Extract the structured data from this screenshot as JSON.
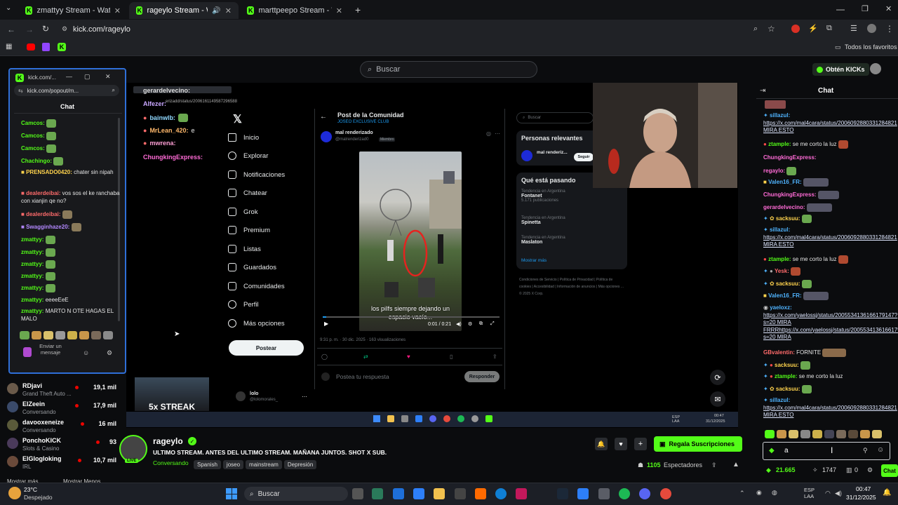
{
  "browser": {
    "tabs": [
      {
        "title": "zmattyy Stream - Watch Live o",
        "active": false
      },
      {
        "title": "rageylo Stream - Watch Liv",
        "active": true
      },
      {
        "title": "marttpeepo Stream - Watch Li",
        "active": false
      }
    ],
    "url": "kick.com/rageylo",
    "bookmarks_all": "Todos los favoritos"
  },
  "kick_header": {
    "search_placeholder": "Buscar",
    "get_kicks": "Obtén KICKs"
  },
  "popup": {
    "title": "kick.com/...",
    "url": "kick.com/popout/m...",
    "chat_title": "Chat",
    "messages": [
      {
        "user": "Camcos:",
        "text": "",
        "color": "#53fc18"
      },
      {
        "user": "Camcos:",
        "text": "",
        "color": "#53fc18"
      },
      {
        "user": "Camcos:",
        "text": "",
        "color": "#53fc18"
      },
      {
        "user": "Chachingo:",
        "text": "",
        "color": "#53fc18"
      },
      {
        "user": "PRENSADO0420:",
        "text": "chater sin nipah",
        "color": "#ffd34d"
      },
      {
        "user": "dealerdeibai:",
        "text": "vos sos el ke ranchaba con xianjin qe no?",
        "color": "#ff6b6b"
      },
      {
        "user": "dealerdeibai:",
        "text": "",
        "color": "#ff6b6b"
      },
      {
        "user": "Swagginhaze20:",
        "text": "",
        "color": "#b388ff"
      },
      {
        "user": "zmattyy:",
        "text": "",
        "color": "#53fc18"
      },
      {
        "user": "zmattyy:",
        "text": "",
        "color": "#53fc18"
      },
      {
        "user": "zmattyy:",
        "text": "",
        "color": "#53fc18"
      },
      {
        "user": "zmattyy:",
        "text": "",
        "color": "#53fc18"
      },
      {
        "user": "zmattyy:",
        "text": "",
        "color": "#53fc18"
      },
      {
        "user": "zmattyy:",
        "text": "eeeeEeE",
        "color": "#53fc18"
      },
      {
        "user": "zmattyy:",
        "text": "MARTO N OTE HAGAS EL MALO",
        "color": "#53fc18"
      }
    ],
    "input_placeholder": "Enviar un mensaje"
  },
  "sidebar": {
    "channels": [
      {
        "name": "RDjavi",
        "category": "Grand Theft Auto ...",
        "viewers": "19,1 mil"
      },
      {
        "name": "ElZeein",
        "category": "Conversando",
        "viewers": "17,9 mil"
      },
      {
        "name": "davooxeneize",
        "category": "Conversando",
        "viewers": "16 mil"
      },
      {
        "name": "PonchoKICK",
        "category": "Slots & Casino",
        "viewers": "93"
      },
      {
        "name": "ElGlogloking",
        "category": "IRL",
        "viewers": "10,7 mil"
      }
    ],
    "show_more": "Mostrar más",
    "show_less": "Mostrar Menos"
  },
  "stream_overlay": {
    "chat": [
      {
        "user": "gerardelvecino:",
        "text": ""
      },
      {
        "user": "Alfezer:",
        "text": ""
      },
      {
        "user": "bainwlb:",
        "text": ""
      },
      {
        "user": "MrLean_420:",
        "text": "e"
      },
      {
        "user": "mwrena:",
        "text": ""
      },
      {
        "user": "ChungkingExpress:",
        "text": ""
      }
    ],
    "streak": "5x STREAK",
    "url_strip": "erizadd/status/2006161149587296588"
  },
  "x_page": {
    "nav": [
      "Inicio",
      "Explorar",
      "Notificaciones",
      "Chatear",
      "Grok",
      "Premium",
      "Listas",
      "Guardados",
      "Comunidades",
      "Perfil",
      "Más opciones"
    ],
    "post_button": "Postear",
    "account_name": "lolo",
    "account_handle": "@lolomorales_",
    "post_header": "Post de la Comunidad",
    "community": "JOSEO EXCLUSIVE CLUB",
    "author": "mal renderizado",
    "handle": "@malrenderizad0",
    "member": "Miembro",
    "caption": "los piIfs siempre dejando un espacio vacío...",
    "video_time": "0:01 / 0:21",
    "meta": "9:31 p. m. · 30 dic. 2025 · 163 visualizaciones",
    "reply_placeholder": "Postea tu respuesta",
    "reply_button": "Responder",
    "search": "Buscar",
    "relevant_title": "Personas relevantes",
    "relevant_name": "mal renderiz...",
    "relevant_follow": "Seguir",
    "happening_title": "Qué está pasando",
    "trends": [
      {
        "context": "Tendencia en Argentina",
        "name": "Fontanet",
        "count": "5.171 publicaciones"
      },
      {
        "context": "Tendencia en Argentina",
        "name": "Spinetta",
        "count": ""
      },
      {
        "context": "Tendencia en Argentina",
        "name": "Maslaton",
        "count": ""
      }
    ],
    "show_more": "Mostrar más",
    "footer": "Condiciones de Servicio | Política de Privacidad | Política de cookies | Accesibilidad | Información de anuncios | Más opciones ... © 2025 X Corp."
  },
  "inner_taskbar": {
    "lang": "ESP\nLAA",
    "time": "00:47",
    "date": "31/12/2025"
  },
  "right_chat": {
    "title": "Chat",
    "messages": [
      {
        "user": "sillazul:",
        "text": "https://x.com/mal4cara/status/2006092880331284821 MIRA ESTO",
        "color": "#4fb3ff",
        "link": true
      },
      {
        "user": "ztample:",
        "text": "se me corto la luz",
        "color": "#53fc18"
      },
      {
        "user": "ChungkingExpress:",
        "text": "",
        "color": "#ff6bd6"
      },
      {
        "user": "regaylo:",
        "text": "",
        "color": "#ff6bd6"
      },
      {
        "user": "Valen16_FR:",
        "text": "",
        "color": "#4fb3ff"
      },
      {
        "user": "ChungkingExpress:",
        "text": "",
        "color": "#ff6bd6"
      },
      {
        "user": "gerardelvecino:",
        "text": "",
        "color": "#ff6bd6"
      },
      {
        "user": "sacksuu:",
        "text": "",
        "color": "#ffd34d"
      },
      {
        "user": "sillazul:",
        "text": "https://x.com/mal4cara/status/2006092880331284821 MIRA ESTO",
        "color": "#4fb3ff",
        "link": true
      },
      {
        "user": "ztample:",
        "text": "se me corto la luz",
        "color": "#53fc18"
      },
      {
        "user": "Yesk:",
        "text": "",
        "color": "#ff6b6b"
      },
      {
        "user": "sacksuu:",
        "text": "",
        "color": "#ffd34d"
      },
      {
        "user": "Valen16_FR:",
        "text": "",
        "color": "#4fb3ff"
      },
      {
        "user": "yaeloxz:",
        "text": "https://x.com/yaelossj/status/2005534136166179147?s=20 MIRA FRRRhttps://x.com/yaelossj/status/2005534136166179147?s=20 MIRA",
        "color": "#4fb3ff",
        "link": true
      },
      {
        "user": "GBvalentin:",
        "text": "FORNITE",
        "color": "#ff6b6b"
      },
      {
        "user": "sacksuu:",
        "text": "",
        "color": "#ffd34d"
      },
      {
        "user": "ztample:",
        "text": "se me corto la luz",
        "color": "#53fc18"
      },
      {
        "user": "sacksuu:",
        "text": "",
        "color": "#ffd34d"
      },
      {
        "user": "sillazul:",
        "text": "https://x.com/mal4cara/status/2006092880331284821 MIRA ESTO",
        "color": "#4fb3ff",
        "link": true
      }
    ],
    "input_value": "a",
    "kicks": "21.665",
    "points": "1747",
    "misc": "0",
    "chat_button": "Chat"
  },
  "stream": {
    "streamer": "rageylo",
    "title": "ULTIMO STREAM. ANTES DEL ULTIMO STREAM. MAÑANA JUNTOS. SHOT X SUB.",
    "category": "Conversando",
    "tags": [
      "Spanish",
      "joseo",
      "mainstream",
      "Depresión"
    ],
    "live": "LIVE",
    "gift_button": "Regala Suscripciones",
    "viewers": "1105",
    "viewers_label": "Espectadores"
  },
  "taskbar": {
    "weather_temp": "23°C",
    "weather_desc": "Despejado",
    "search": "Buscar",
    "lang": "ESP\nLAA",
    "time": "00:47",
    "date": "31/12/2025"
  }
}
